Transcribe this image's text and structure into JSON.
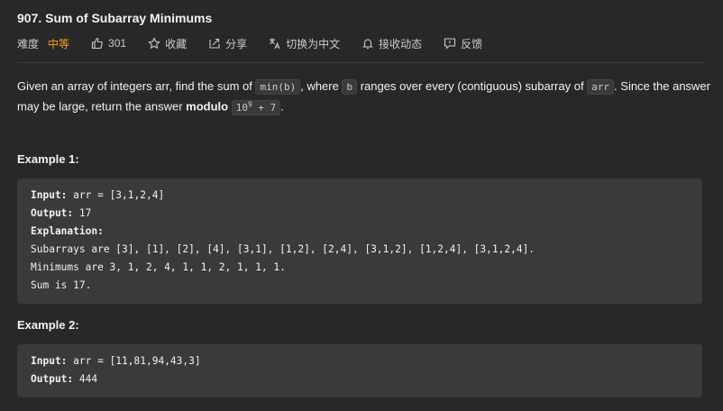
{
  "problem": {
    "title": "907. Sum of Subarray Minimums"
  },
  "meta": {
    "difficulty_label": "难度",
    "difficulty_value": "中等",
    "difficulty_color": "#f0a020",
    "likes": "301",
    "favorite_label": "收藏",
    "share_label": "分享",
    "switch_lang_label": "切换为中文",
    "subscribe_label": "接收动态",
    "feedback_label": "反馈"
  },
  "description": {
    "part1": "Given an array of integers arr, find the sum of ",
    "code1": "min(b)",
    "part2": ", where ",
    "code2": "b",
    "part3": " ranges over every (contiguous) subarray of ",
    "code3": "arr",
    "part4": ". Since the answer may be large, return the answer ",
    "bold": "modulo",
    "code4_base": "10",
    "code4_exp": "9",
    "code4_rest": " + 7",
    "part5": "."
  },
  "examples": [
    {
      "label": "Example 1:",
      "input_key": "Input:",
      "input_val": " arr = [3,1,2,4]",
      "output_key": "Output:",
      "output_val": " 17",
      "explanation_key": "Explanation:",
      "explanation_lines": [
        "Subarrays are [3], [1], [2], [4], [3,1], [1,2], [2,4], [3,1,2], [1,2,4], [3,1,2,4].",
        "Minimums are 3, 1, 2, 4, 1, 1, 2, 1, 1, 1.",
        "Sum is 17."
      ]
    },
    {
      "label": "Example 2:",
      "input_key": "Input:",
      "input_val": " arr = [11,81,94,43,3]",
      "output_key": "Output:",
      "output_val": " 444"
    }
  ]
}
